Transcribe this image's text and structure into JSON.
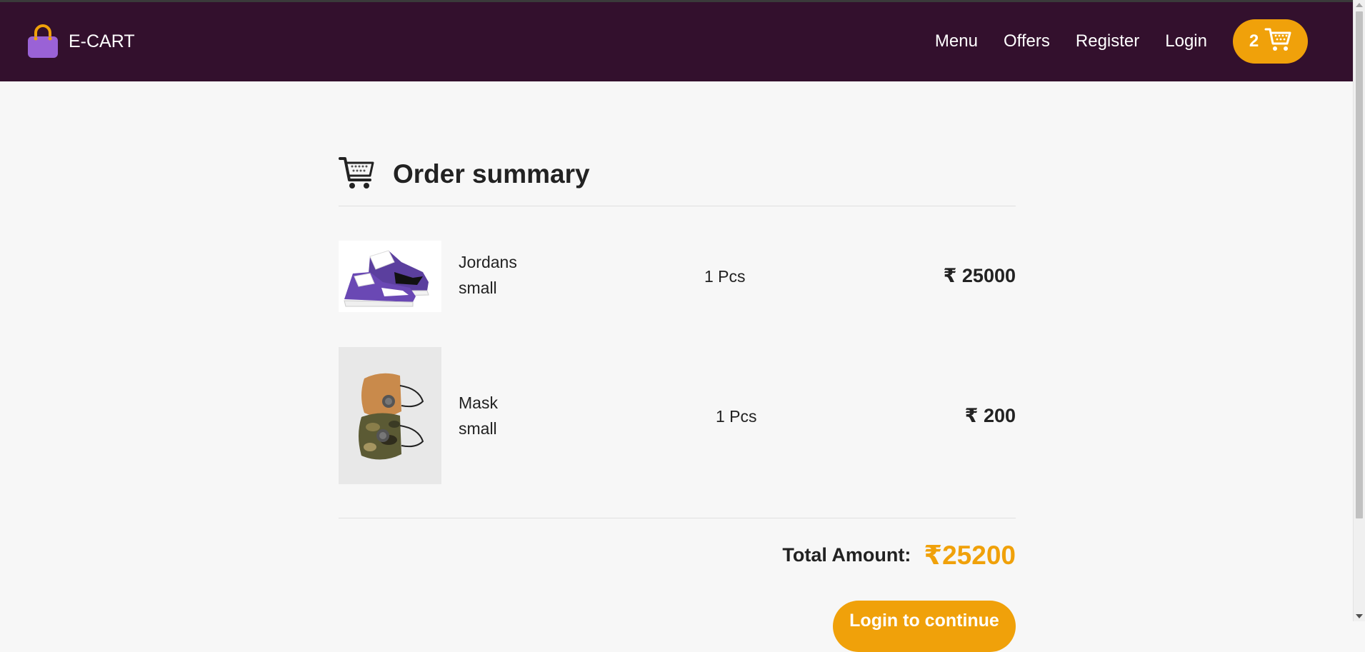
{
  "navbar": {
    "brand_name": "E-CART",
    "brand_icon": "shopping-bag-icon",
    "links": [
      "Menu",
      "Offers",
      "Register",
      "Login"
    ],
    "cart_count": "2",
    "cart_icon": "cart-icon"
  },
  "summary": {
    "title": "Order summary",
    "icon": "cart-icon",
    "items": [
      {
        "name": "Jordans",
        "size": "small",
        "qty": "1 Pcs",
        "price": "₹ 25000",
        "image": "sneaker-image"
      },
      {
        "name": "Mask",
        "size": "small",
        "qty": "1 Pcs",
        "price": "₹ 200",
        "image": "mask-image"
      }
    ],
    "total_label": "Total Amount:",
    "total_value": "₹25200",
    "cta_label": "Login to continue"
  },
  "colors": {
    "navbar_bg": "#33102d",
    "accent": "#f0a10a",
    "page_bg": "#f7f7f7"
  }
}
